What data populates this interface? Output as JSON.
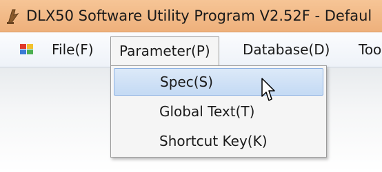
{
  "window": {
    "title": "DLX50 Software Utility Program V2.52F - Defaul"
  },
  "menubar": {
    "items": [
      {
        "label": "File(F)"
      },
      {
        "label": "Parameter(P)",
        "open": true
      },
      {
        "label": "Database(D)"
      },
      {
        "label": "Too"
      }
    ]
  },
  "dropdown": {
    "items": [
      {
        "label": "Spec(S)",
        "highlighted": true
      },
      {
        "label": "Global Text(T)"
      },
      {
        "label": "Shortcut Key(K)"
      }
    ]
  },
  "colors": {
    "titlebar": "#eeb07b",
    "highlight": "#c4daf4",
    "highlight_border": "#8db2e3"
  }
}
